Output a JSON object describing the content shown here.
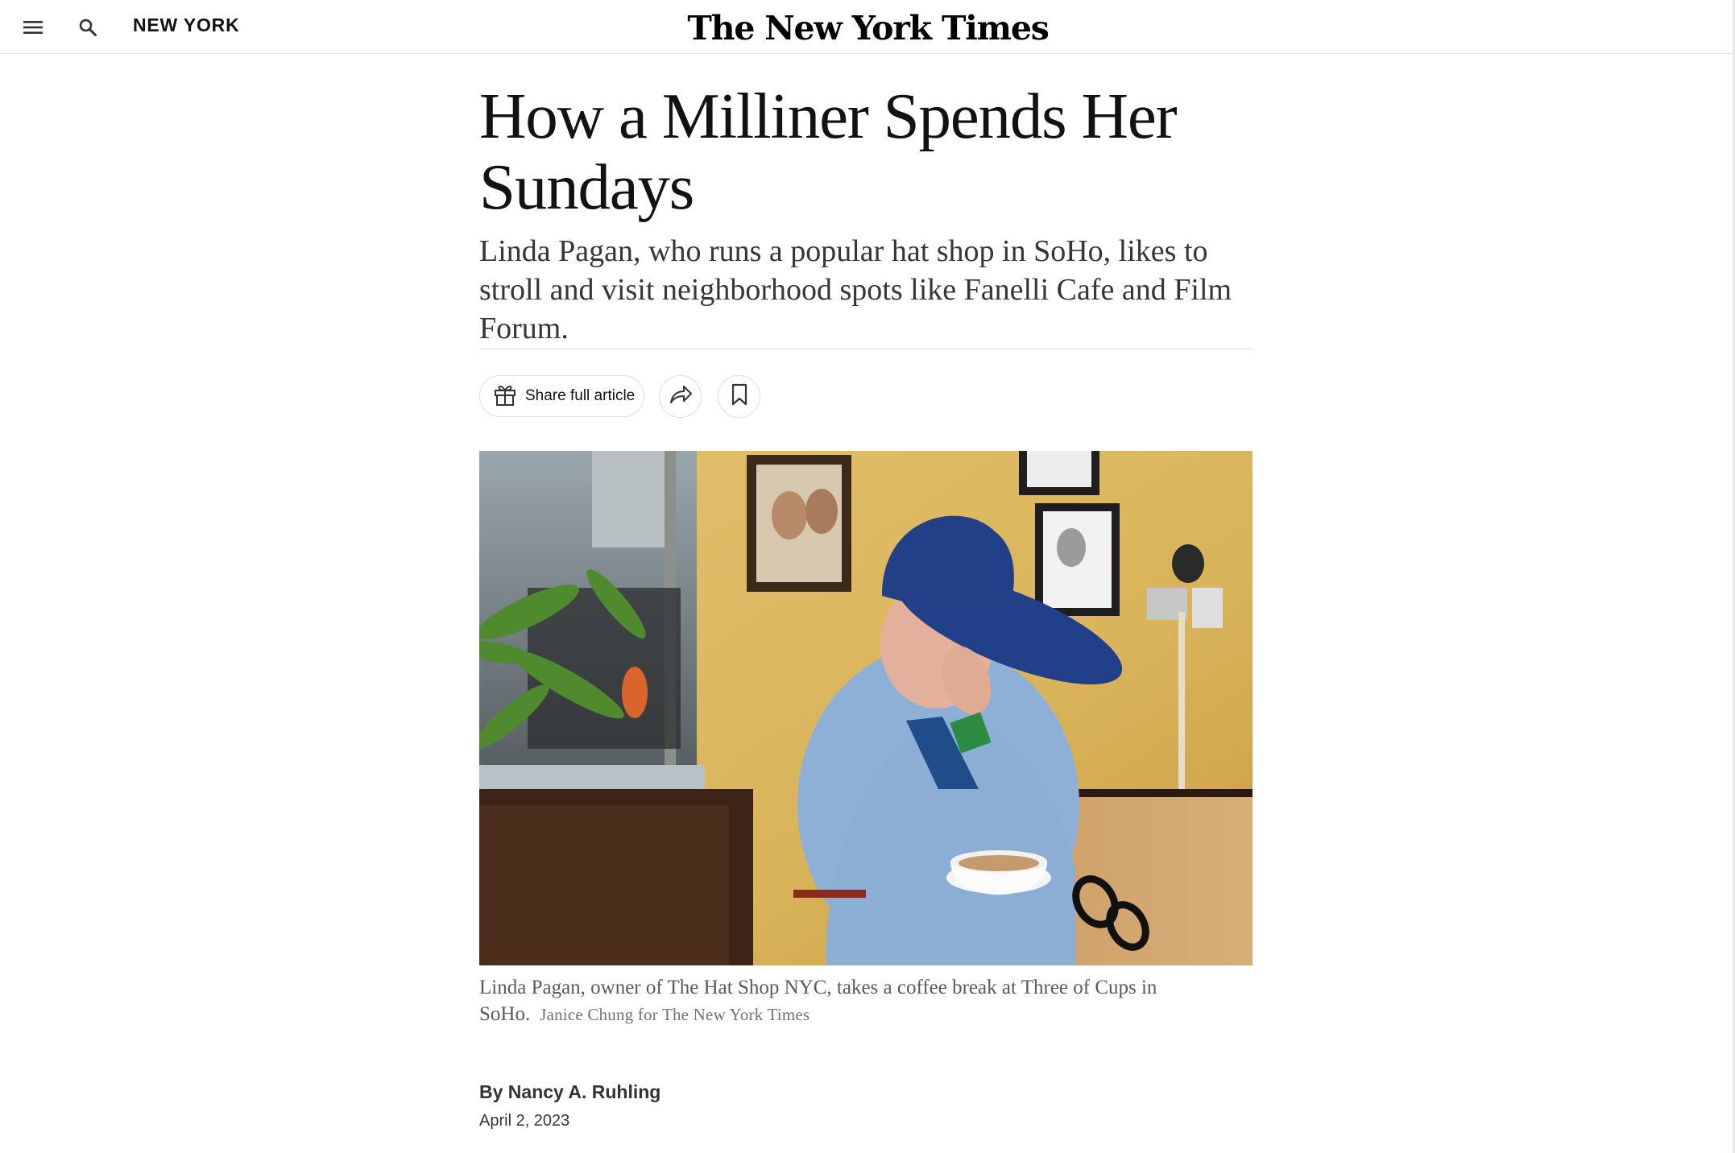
{
  "masthead": {
    "menu_icon": "hamburger-menu-icon",
    "search_icon": "search-icon",
    "section": "NEW YORK",
    "logo": "The New York Times"
  },
  "article": {
    "headline": "How a Milliner Spends Her Sundays",
    "summary": "Linda Pagan, who runs a popular hat shop in SoHo, likes to stroll and visit neighborhood spots like Fanelli Cafe and Film Forum.",
    "share_label": "Share full article",
    "share_icon": "gift-icon",
    "forward_icon": "share-arrow-icon",
    "save_icon": "bookmark-icon",
    "caption": "Linda Pagan, owner of The Hat Shop NYC, takes a coffee break at Three of Cups in SoHo.",
    "credit": "Janice Chung for The New York Times",
    "byline_prefix": "By",
    "author": "Nancy A. Ruhling",
    "date": "April 2, 2023"
  },
  "colors": {
    "text": "#121212",
    "muted": "#5a5a5a",
    "rule": "#dfdfdf"
  }
}
